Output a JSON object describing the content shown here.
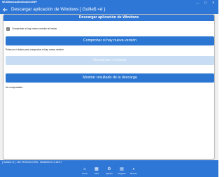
{
  "window": {
    "title": "WUDBasicauthenticationUWP",
    "controls": {
      "minimize": "—",
      "maximize": "☐",
      "close": "✕"
    }
  },
  "header": {
    "back_icon": "back-arrow-icon",
    "title": "Descargar aplicación de Windows  [ Guille$ <é }"
  },
  "card": {
    "title": "Descargar aplicación de Windows",
    "checkbox": {
      "label": "Comprobar si hay nueva versión al iniciar",
      "checked": true,
      "mark": "✓"
    },
    "check_button_label": "Comprobar si hay nueva versión",
    "instructions": "Pulsa en el botón para comprobar si hay nueva versión.",
    "download_button_label": "Descargar e instalar",
    "download_button_enabled": false,
    "show_result_button_label": "Mostrar resultado de la descarga",
    "status_text": "No comprobado."
  },
  "statusbar": {
    "text": "[ Guille$ <é ] - BD PRODUCCIÓN - 26/08/2022 12:18:37"
  },
  "bottom_nav": {
    "items": [
      {
        "label": "Home",
        "icon": "⌂",
        "icon_name": "home-icon"
      },
      {
        "label": "Tiles",
        "icon": "▦",
        "icon_name": "tiles-icon"
      },
      {
        "label": "Ajustes",
        "icon": "⚙",
        "icon_name": "settings-icon"
      },
      {
        "label": "Registro",
        "icon": "▤",
        "icon_name": "registry-icon"
      },
      {
        "label": "Buscar",
        "icon": "⌕",
        "icon_name": "search-icon"
      }
    ]
  },
  "colors": {
    "accent": "#2f77d6",
    "button": "#2a76d2",
    "button_disabled": "#c8dcf4",
    "background": "#f0f0f0"
  }
}
